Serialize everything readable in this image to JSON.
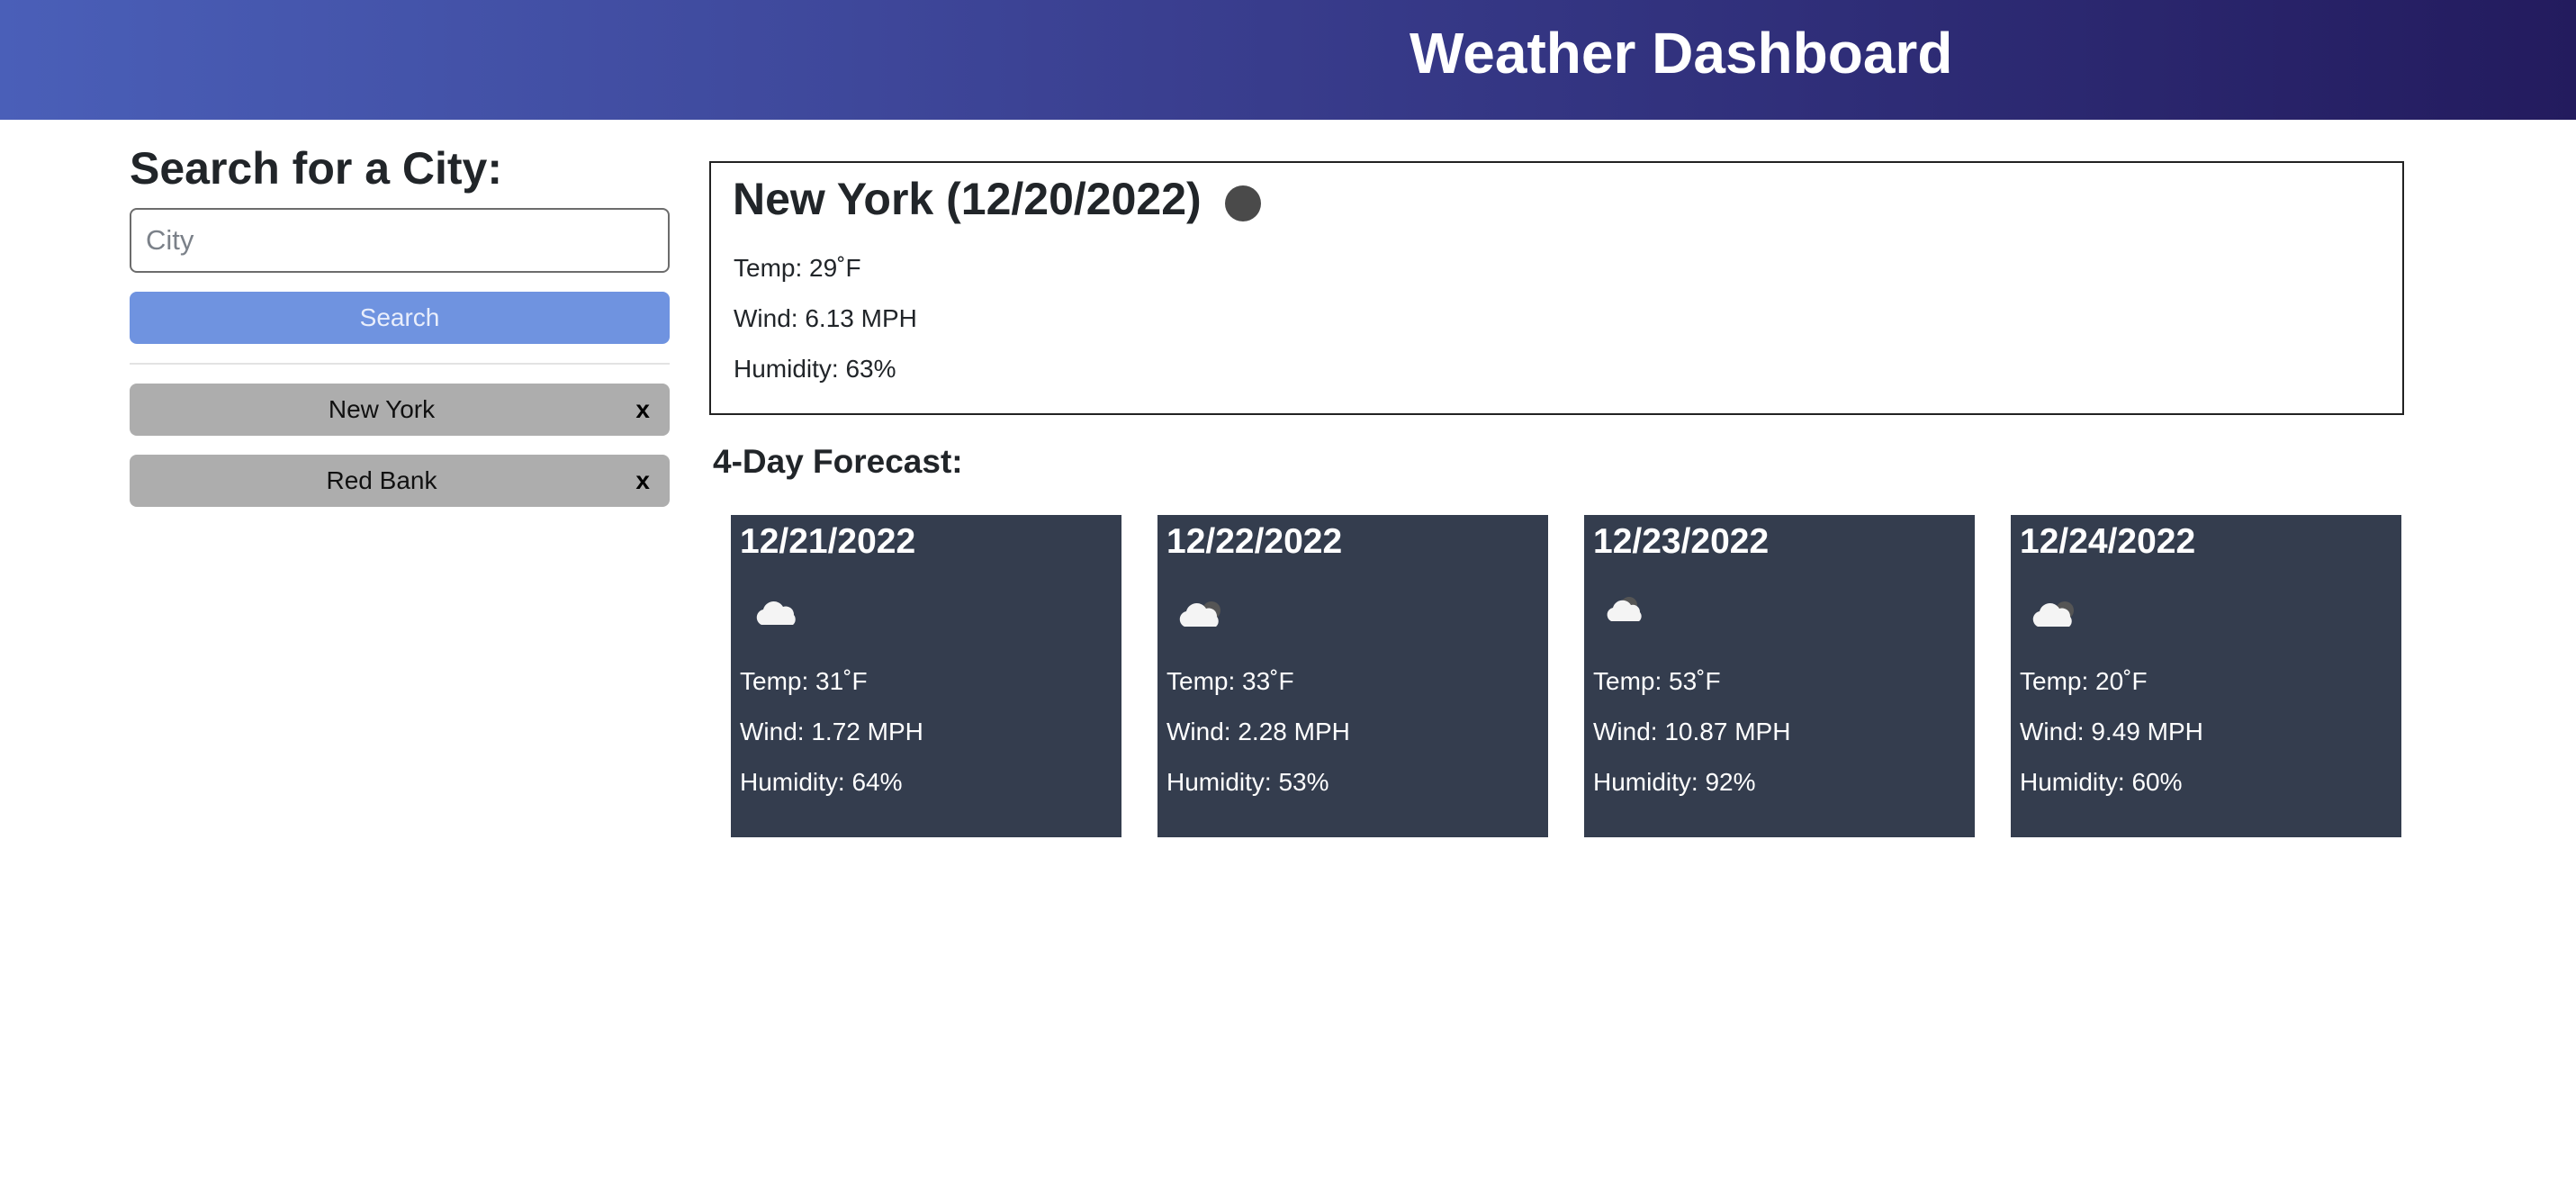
{
  "header": {
    "title": "Weather Dashboard"
  },
  "search": {
    "heading": "Search for a City:",
    "placeholder": "City",
    "value": "",
    "button_label": "Search"
  },
  "history": [
    {
      "label": "New York",
      "remove_label": "x"
    },
    {
      "label": "Red Bank",
      "remove_label": "x"
    }
  ],
  "current": {
    "title": "New York (12/20/2022)",
    "icon": "night-clear-icon",
    "temp": "Temp: 29˚F",
    "wind": "Wind: 6.13 MPH",
    "humidity": "Humidity: 63%"
  },
  "forecast": {
    "title": "4-Day Forecast:",
    "days": [
      {
        "date": "12/21/2022",
        "icon": "cloud-icon",
        "temp": "Temp: 31˚F",
        "wind": "Wind: 1.72 MPH",
        "humidity": "Humidity: 64%"
      },
      {
        "date": "12/22/2022",
        "icon": "cloud-moon-icon",
        "temp": "Temp: 33˚F",
        "wind": "Wind: 2.28 MPH",
        "humidity": "Humidity: 53%"
      },
      {
        "date": "12/23/2022",
        "icon": "cloud-moon-icon",
        "temp": "Temp: 53˚F",
        "wind": "Wind: 10.87 MPH",
        "humidity": "Humidity: 92%"
      },
      {
        "date": "12/24/2022",
        "icon": "cloud-moon-icon",
        "temp": "Temp: 20˚F",
        "wind": "Wind: 9.49 MPH",
        "humidity": "Humidity: 60%"
      }
    ]
  },
  "colors": {
    "header_start": "#4a5fb8",
    "header_end": "#231b5e",
    "search_button": "#6f93e0",
    "history_item": "#adadad",
    "card_bg": "#343d4e"
  }
}
